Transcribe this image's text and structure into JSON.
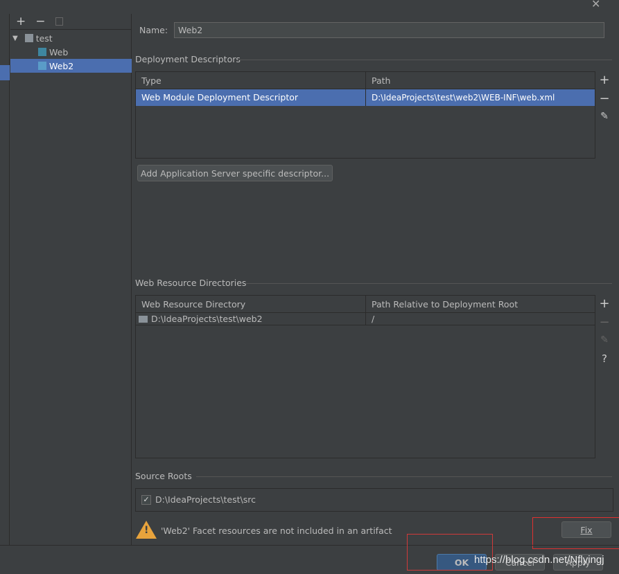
{
  "window": {
    "close_icon": "close-icon"
  },
  "tree": {
    "toolbar": {
      "add": "+",
      "remove": "−",
      "copy_icon": "copy-icon"
    },
    "nodes": [
      {
        "label": "test",
        "icon": "module-folder-icon"
      },
      {
        "label": "Web",
        "icon": "web-facet-icon"
      },
      {
        "label": "Web2",
        "icon": "web-facet-icon",
        "selected": true
      }
    ]
  },
  "name": {
    "label": "Name:",
    "value": "Web2"
  },
  "deployment": {
    "title": "Deployment Descriptors",
    "columns": [
      "Type",
      "Path"
    ],
    "rows": [
      [
        "Web Module Deployment Descriptor",
        "D:\\IdeaProjects\\test\\web2\\WEB-INF\\web.xml"
      ]
    ],
    "add_server_button": "Add Application Server specific descriptor..."
  },
  "resources": {
    "title": "Web Resource Directories",
    "columns": [
      "Web Resource Directory",
      "Path Relative to Deployment Root"
    ],
    "rows": [
      [
        "D:\\IdeaProjects\\test\\web2",
        "/"
      ]
    ],
    "help": "?"
  },
  "source_roots": {
    "title": "Source Roots",
    "items": [
      {
        "label": "D:\\IdeaProjects\\test\\src",
        "checked": true
      }
    ]
  },
  "warning": {
    "text": "'Web2' Facet resources are not included in an artifact",
    "fix": "Fix"
  },
  "footer": {
    "ok": "OK",
    "cancel": "Cancel",
    "apply": "Apply"
  },
  "watermark": "https://blog.csdn.net/Nflyingj",
  "colors": {
    "selection": "#4b6eaf",
    "background": "#3c3f41",
    "annotation": "#e03030"
  }
}
